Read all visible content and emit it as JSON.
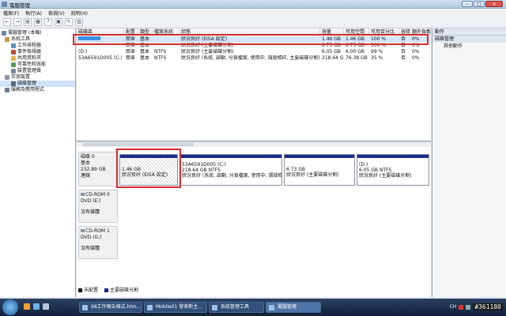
{
  "window": {
    "title": "電腦管理"
  },
  "menu": [
    "檔案(F)",
    "執行(A)",
    "檢視(V)",
    "說明(H)"
  ],
  "toolbar": [
    "←",
    "→",
    "▤",
    "▦",
    "?",
    "▣",
    "✎",
    "▥"
  ],
  "tree": [
    {
      "label": "電腦管理 (本機)",
      "level": 0
    },
    {
      "label": "系統工具",
      "level": 1
    },
    {
      "label": "工作排程器",
      "level": 2
    },
    {
      "label": "事件檢視器",
      "level": 2
    },
    {
      "label": "共用資料夾",
      "level": 2
    },
    {
      "label": "可靠性和效能",
      "level": 2
    },
    {
      "label": "裝置管理員",
      "level": 2
    },
    {
      "label": "存放裝置",
      "level": 1
    },
    {
      "label": "磁碟管理",
      "level": 2,
      "selected": true
    },
    {
      "label": "服務及應用程式",
      "level": 1
    }
  ],
  "volumes": {
    "headers": [
      "磁碟區",
      "配置",
      "類型",
      "檔案系統",
      "狀態",
      "容量",
      "可用空間",
      "可用百分比",
      "容錯",
      "額外負載"
    ],
    "rows": [
      [
        "",
        "簡單",
        "基本",
        "",
        "狀況良好 (EISA 設定)",
        "1.46 GB",
        "1.46 GB",
        "100 %",
        "否",
        "0%"
      ],
      [
        "",
        "簡單",
        "基本",
        "",
        "狀況良好 (主要磁碟分割)",
        "6.73 GB",
        "6.73 GB",
        "100 %",
        "否",
        "0%"
      ],
      [
        "(D:)",
        "簡單",
        "基本",
        "NTFS",
        "狀況良好 (主要磁碟分割)",
        "6.05 GB",
        "6.00 GB",
        "99 %",
        "否",
        "0%"
      ],
      [
        "53A6591D005 (C:)",
        "簡單",
        "基本",
        "NTFS",
        "狀況良好 (系統, 啟動, 分頁檔案, 使用中, 損毀傾印, 主要磁碟分割)",
        "218.64 GB",
        "76.38 GB",
        "35 %",
        "否",
        "0%"
      ]
    ]
  },
  "disks": [
    {
      "name": "磁碟 0",
      "type": "基本",
      "size": "232.89 GB",
      "status": "連線",
      "partitions": [
        {
          "l1": "1.46 GB",
          "l2": "狀況良好 (EISA 設定)"
        },
        {
          "l1": "53A6591D005  (C:)",
          "l2": "218.64 GB NTFS",
          "l3": "狀況良好 (系統, 啟動, 分頁檔案, 使用中, 損毀傾印"
        },
        {
          "l1": "6.73 GB",
          "l2": "狀況良好 (主要磁碟分割)"
        },
        {
          "l1": "(D:)",
          "l2": "6.05 GB NTFS",
          "l3": "狀況良好 (主要磁碟分割)"
        }
      ]
    },
    {
      "name": "CD-ROM 0",
      "type": "DVD (E:)",
      "media": "沒有媒體"
    },
    {
      "name": "CD-ROM 1",
      "type": "DVD (G:)",
      "media": "沒有媒體"
    }
  ],
  "legend": [
    {
      "label": "未配置",
      "color": "#111111"
    },
    {
      "label": "主要磁碟分割",
      "color": "#1c2b8a"
    }
  ],
  "actions": {
    "header": "動作",
    "section": "磁碟管理",
    "item": "其他動作"
  },
  "taskbar": {
    "tasks": [
      "98工作報告格式.htm...",
      "Mobile01 發表新主...",
      "系統管理工具",
      "電腦管理"
    ],
    "tray": "CH",
    "badge": "#361180"
  }
}
